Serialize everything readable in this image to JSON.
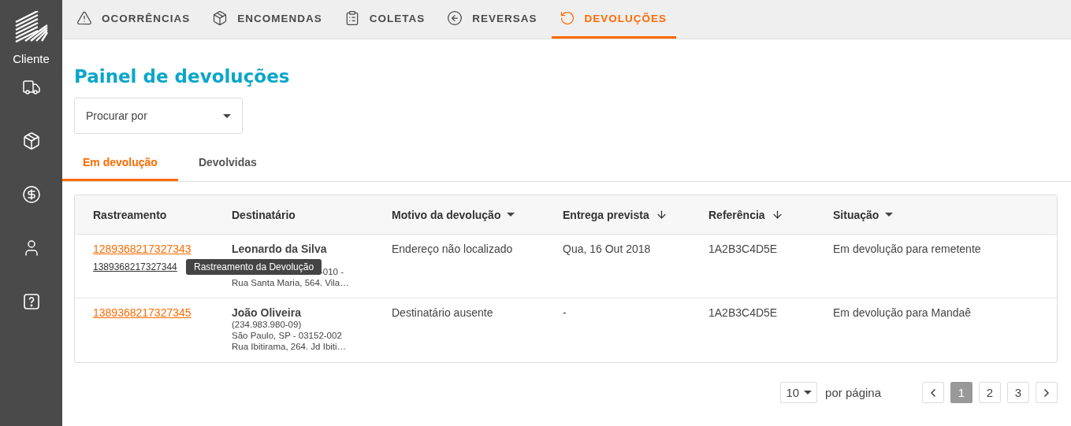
{
  "sidebar": {
    "label": "Cliente",
    "items": [
      {
        "kind": "truck",
        "selected": false
      },
      {
        "kind": "box",
        "selected": false
      },
      {
        "kind": "dollar",
        "selected": false
      },
      {
        "kind": "user",
        "selected": false
      },
      {
        "kind": "help",
        "selected": false
      }
    ]
  },
  "topnav": [
    {
      "label": "OCORRÊNCIAS",
      "kind": "alert",
      "selected": false
    },
    {
      "label": "ENCOMENDAS",
      "kind": "box",
      "selected": false
    },
    {
      "label": "COLETAS",
      "kind": "clipboard",
      "selected": false
    },
    {
      "label": "REVERSAS",
      "kind": "reverse",
      "selected": false
    },
    {
      "label": "DEVOLUÇÕES",
      "kind": "return",
      "selected": true
    }
  ],
  "page_title": "Painel de devoluções",
  "search_select": {
    "placeholder": "Procurar por"
  },
  "tabs": [
    {
      "label": "Em devolução",
      "selected": true
    },
    {
      "label": "Devolvidas",
      "selected": false
    }
  ],
  "table": {
    "columns": [
      {
        "label": "Rastreamento",
        "kind": "plain"
      },
      {
        "label": "Destinatário",
        "kind": "plain"
      },
      {
        "label": "Motivo da devolução",
        "kind": "filter"
      },
      {
        "label": "Entrega prevista",
        "kind": "sort"
      },
      {
        "label": "Referência",
        "kind": "sort"
      },
      {
        "label": "Situação",
        "kind": "filter"
      }
    ],
    "rows": [
      {
        "tracking": "1289368217327343",
        "return_tracking": "1389368217327344",
        "tooltip": "Rastreamento da Devolução",
        "recipient": {
          "name": "Leonardo da Silva",
          "covered_fragment": "-010 -",
          "lines": [
            "Rua Santa Maria, 564. Vila…"
          ]
        },
        "reason": "Endereço não localizado",
        "delivery": "Qua, 16 Out 2018",
        "reference": "1A2B3C4D5E",
        "status": "Em devolução para remetente"
      },
      {
        "tracking": "1389368217327345",
        "recipient": {
          "name": "João Oliveira",
          "lines": [
            "(234.983.980-09)",
            "São Paulo, SP - 03152-002",
            "Rua Ibitirama, 264. Jd Ibiti…"
          ]
        },
        "reason": "Destinatário ausente",
        "delivery": "-",
        "reference": "1A2B3C4D5E",
        "status": "Em devolução para Mandaê"
      }
    ]
  },
  "pagination": {
    "per_page": "10",
    "per_page_label": "por página",
    "pages": [
      {
        "label": "1",
        "selected": true
      },
      {
        "label": "2",
        "selected": false
      },
      {
        "label": "3",
        "selected": false
      }
    ]
  }
}
